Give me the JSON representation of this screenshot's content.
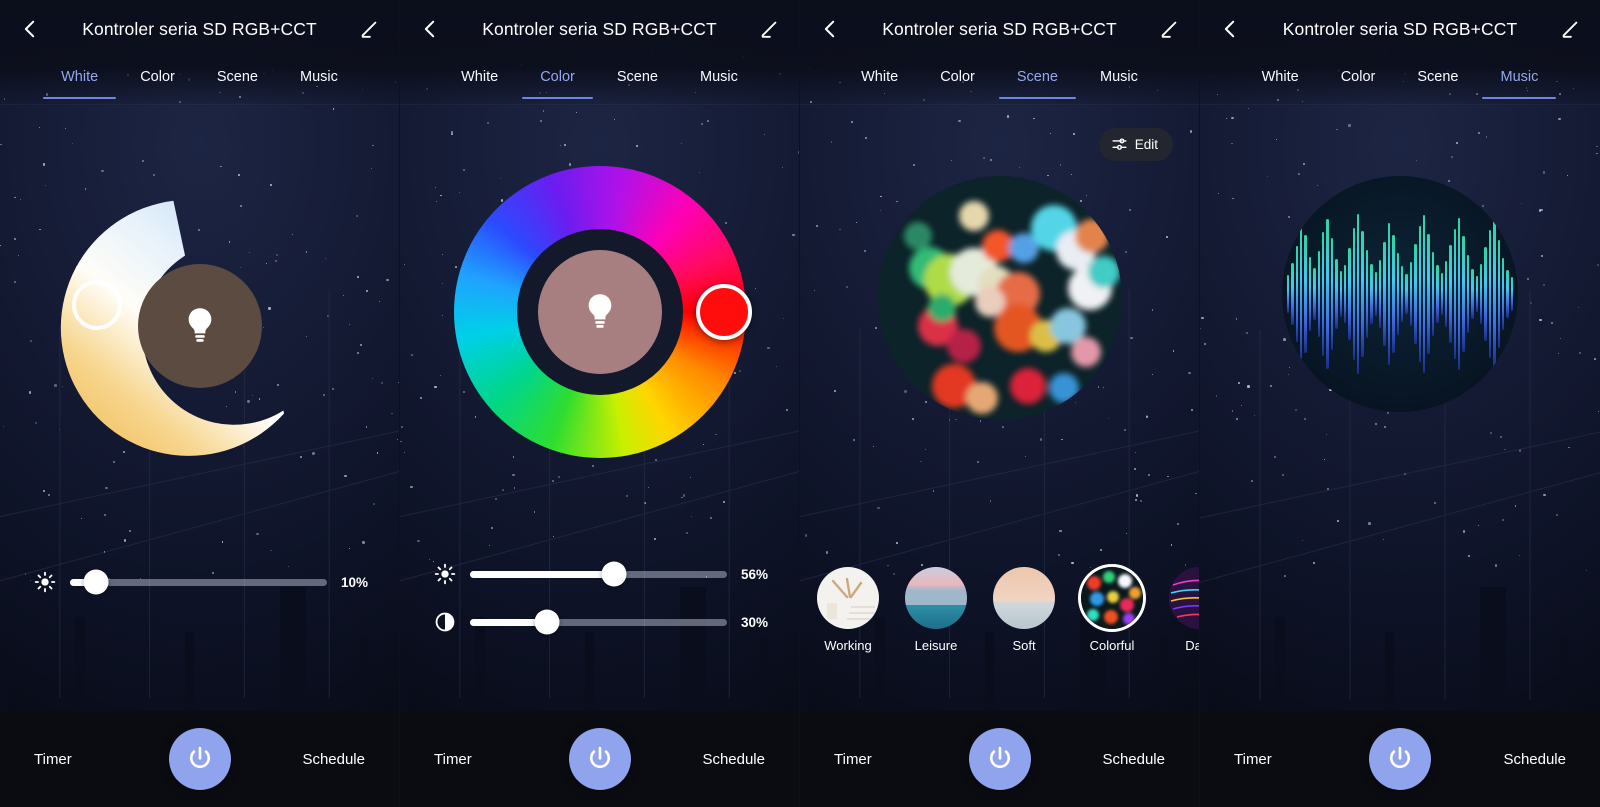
{
  "app": {
    "title": "Kontroler seria SD RGB+CCT",
    "back_icon": "chevron-left-icon",
    "edit_icon": "pencil-icon"
  },
  "tabs": [
    {
      "label": "White"
    },
    {
      "label": "Color"
    },
    {
      "label": "Scene"
    },
    {
      "label": "Music"
    }
  ],
  "bottom": {
    "timer_label": "Timer",
    "schedule_label": "Schedule",
    "power_icon": "power-icon"
  },
  "colors": {
    "accent": "#8fa4ec",
    "tab_active": "#93a8ef",
    "tab_underline": "#6f86e0",
    "slider_fill": "#ffffff",
    "slider_track": "#e6ebff",
    "selected_hue": "#ff0d0d",
    "cct_warm": "#f5c262",
    "cct_cool": "#cfe6f7",
    "bottom_bar": "#0b0c11"
  },
  "panels": [
    {
      "name": "white",
      "active_tab": "White",
      "center_icon": "lightbulb-icon",
      "center_disc_color": "#5b4b40",
      "cct_handle_position_pct": 18,
      "sliders": [
        {
          "name": "brightness",
          "icon": "sun-icon",
          "value": 10,
          "label": "10%"
        }
      ]
    },
    {
      "name": "color",
      "active_tab": "Color",
      "center_icon": "lightbulb-icon",
      "center_disc_color": "#a87f80",
      "selected_color": "#ff0d0d",
      "sliders": [
        {
          "name": "brightness",
          "icon": "sun-icon",
          "value": 56,
          "label": "56%"
        },
        {
          "name": "saturation",
          "icon": "contrast-icon",
          "value": 30,
          "label": "30%"
        }
      ]
    },
    {
      "name": "scene",
      "active_tab": "Scene",
      "edit_label": "Edit",
      "edit_icon": "tune-icon",
      "preview": "colorful-bokeh",
      "scenes": [
        {
          "label": "Working",
          "selected": false
        },
        {
          "label": "Leisure",
          "selected": false
        },
        {
          "label": "Soft",
          "selected": false
        },
        {
          "label": "Colorful",
          "selected": true
        },
        {
          "label": "Dazz",
          "selected": false
        }
      ]
    },
    {
      "name": "music",
      "active_tab": "Music",
      "visualizer": "audio-spectrum"
    }
  ]
}
